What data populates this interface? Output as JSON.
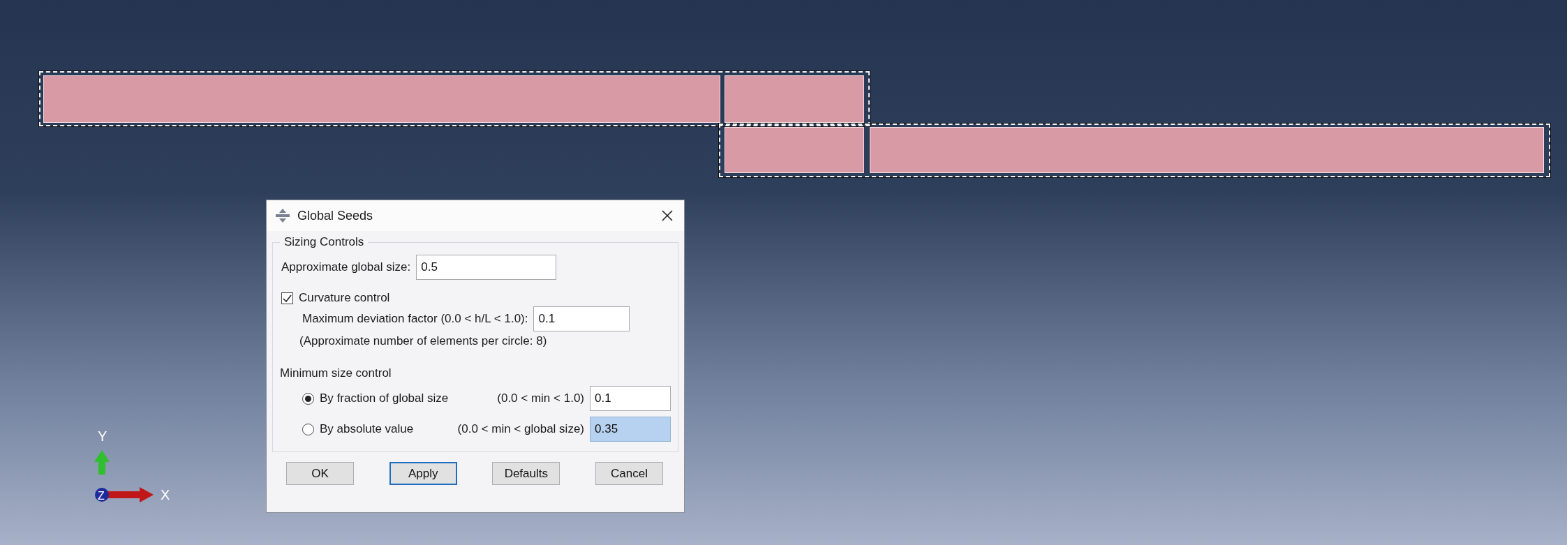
{
  "viewport": {
    "axis_labels": {
      "y": "Y",
      "z": "Z",
      "x": "X"
    }
  },
  "dialog": {
    "title": "Global Seeds",
    "sizing_group": {
      "title": "Sizing Controls",
      "global_size": {
        "label": "Approximate global size:",
        "value": "0.5"
      },
      "curvature": {
        "label": "Curvature control",
        "checked": true
      },
      "deviation": {
        "label": "Maximum deviation factor (0.0 < h/L < 1.0):",
        "value": "0.1"
      },
      "elements_note": "(Approximate number of elements per circle: 8)",
      "minimum_title": "Minimum size control",
      "options": [
        {
          "label": "By fraction of global size",
          "range": "(0.0 < min < 1.0)",
          "value": "0.1",
          "selected": true,
          "highlighted": false
        },
        {
          "label": "By absolute value",
          "range": "(0.0 < min < global size)",
          "value": "0.35",
          "selected": false,
          "highlighted": true
        }
      ]
    },
    "buttons": [
      {
        "label": "OK",
        "focused": false
      },
      {
        "label": "Apply",
        "focused": true
      },
      {
        "label": "Defaults",
        "focused": false
      },
      {
        "label": "Cancel",
        "focused": false
      }
    ]
  }
}
